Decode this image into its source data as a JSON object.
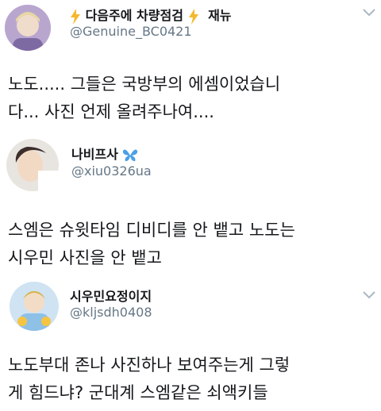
{
  "tweets": [
    {
      "display_name_part1": "다음주에 차량점검",
      "display_name_part2": "재뉴",
      "name_icon": "lightning-bolt-icon",
      "handle": "@Genuine_BC0421",
      "text_lines": [
        "노도..... 그들은 국방부의 에셈이었습니",
        "다... 사진 언제 올려주나여...."
      ]
    },
    {
      "display_name": "나비프사",
      "name_icon": "butterfly-icon",
      "handle": "@xiu0326ua",
      "text_lines": [
        "스엠은 슈윗타임 디비디를 안 뱉고 노도는",
        "시우민 사진을 안 뱉고"
      ]
    },
    {
      "display_name": "시우민요정이지",
      "handle": "@kljsdh0408",
      "text_lines": [
        "노도부대 존나 사진하나 보여주는게 그렇",
        "게 힘드냐? 군대계 스엠같은 쇠액키들"
      ]
    }
  ],
  "colors": {
    "text": "#14171a",
    "secondary": "#657786",
    "lightning": "#f5b82e",
    "butterfly": "#4a9fe8",
    "chevron": "#aab8c2"
  }
}
